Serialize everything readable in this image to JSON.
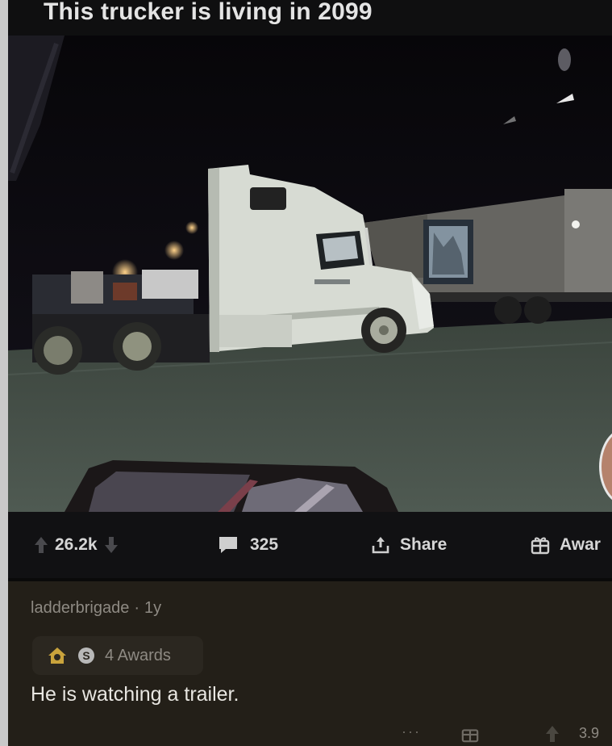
{
  "post": {
    "title": "This trucker is living in 2099"
  },
  "actions": {
    "upvotes": "26.2k",
    "comments": "325",
    "share_label": "Share",
    "award_label": "Awar"
  },
  "comment": {
    "username": "ladderbrigade",
    "separator": "·",
    "age": "1y",
    "awards_label": "4 Awards",
    "body": "He is watching a trailer.",
    "more": "···",
    "score": "3.9"
  },
  "icons": {
    "upvote": "arrow-up-icon",
    "downvote": "arrow-down-icon",
    "comment": "comment-bubble-icon",
    "share": "share-icon",
    "award": "gift-icon",
    "silver_award": "silver-award-icon",
    "home_award": "house-award-icon"
  },
  "colors": {
    "title_bar": "#0f0f10",
    "action_bar": "#111113",
    "comment_bg": "#231f18",
    "meta_text": "#8e8a83"
  }
}
